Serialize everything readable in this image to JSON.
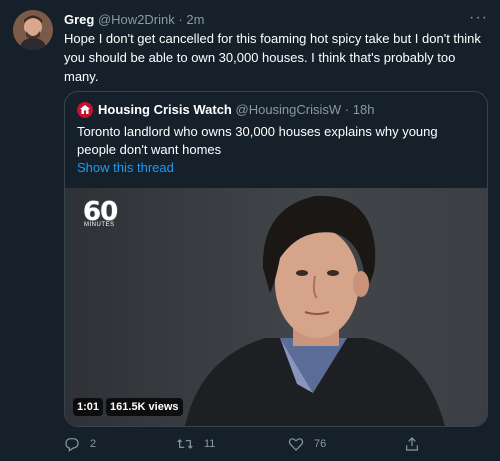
{
  "tweet": {
    "author_name": "Greg",
    "author_handle": "@How2Drink",
    "separator": "·",
    "time": "2m",
    "text": "Hope I don't get cancelled for this foaming hot spicy take but I don't think you should be able to own 30,000 houses. I think that's probably too many.",
    "more_label": "···"
  },
  "quote": {
    "author_name": "Housing Crisis Watch",
    "author_handle": "@HousingCrisisW",
    "separator": "·",
    "time": "18h",
    "text": "Toronto landlord who owns 30,000 houses explains why young people don't want homes",
    "show_thread": "Show this thread",
    "media": {
      "logo_text": "60",
      "logo_subtext": "MINUTES",
      "duration": "1:01",
      "views": "161.5K views"
    }
  },
  "actions": {
    "reply_count": "2",
    "retweet_count": "11",
    "like_count": "76"
  },
  "icons": {
    "reply": "reply-icon",
    "retweet": "retweet-icon",
    "like": "heart-icon",
    "share": "share-icon"
  },
  "colors": {
    "background": "#15202b",
    "secondary_text": "#8b98a5",
    "link": "#1d9bf0",
    "border": "#38444d"
  }
}
